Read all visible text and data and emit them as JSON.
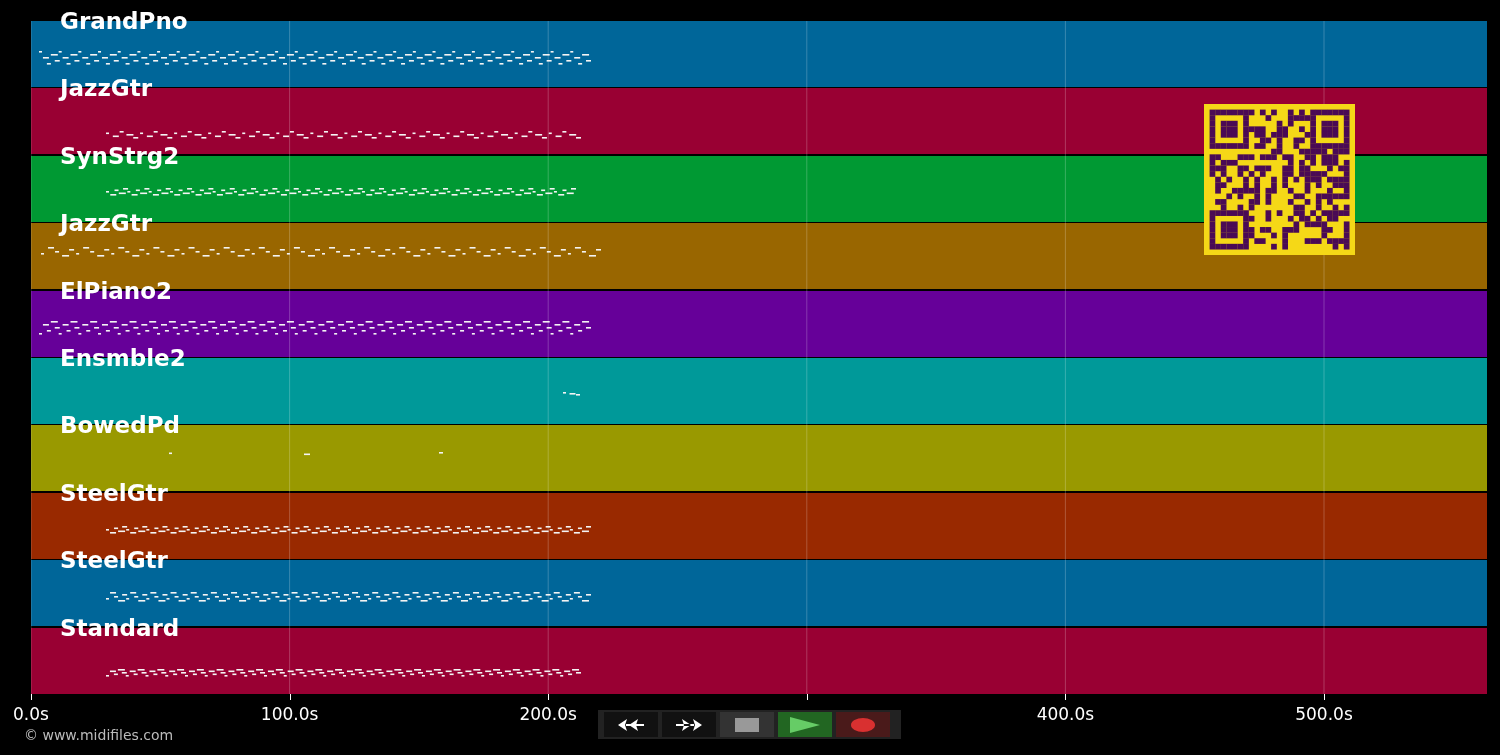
{
  "tracks": [
    {
      "name": "GrandPno",
      "color": "#006699"
    },
    {
      "name": "JazzGtr",
      "color": "#990033"
    },
    {
      "name": "SynStrg2",
      "color": "#009933"
    },
    {
      "name": "JazzGtr",
      "color": "#996600"
    },
    {
      "name": "ElPiano2",
      "color": "#660099"
    },
    {
      "name": "Ensmble2",
      "color": "#009999"
    },
    {
      "name": "BowedPd",
      "color": "#999900"
    },
    {
      "name": "SteelGtr",
      "color": "#992900"
    },
    {
      "name": "SteelGtr",
      "color": "#006699"
    },
    {
      "name": "Standard",
      "color": "#990033"
    }
  ],
  "axis": {
    "ticks": [
      "0.0s",
      "100.0s",
      "200.0s",
      "400.0s",
      "500.0s"
    ]
  },
  "controls": [
    {
      "kind": "rewind"
    },
    {
      "kind": "forward"
    },
    {
      "kind": "stop"
    },
    {
      "kind": "play"
    },
    {
      "kind": "record"
    }
  ],
  "footer": {
    "copyright": "© www.midifiles.com"
  }
}
